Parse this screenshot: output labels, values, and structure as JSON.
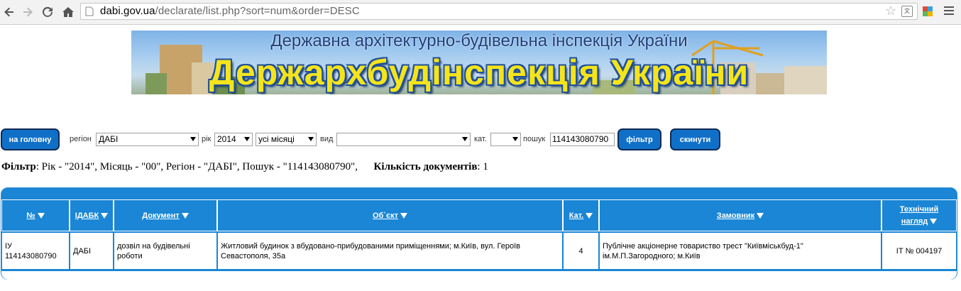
{
  "browser": {
    "url_host": "dabi.gov.ua",
    "url_path": "/declarate/list.php?sort=num&order=DESC"
  },
  "banner": {
    "subtitle": "Державна архітектурно-будівельна інспекція України",
    "title": "Держархбудінспекція України"
  },
  "form": {
    "home_button": "на головну",
    "region_label": "регіон",
    "region_value": "ДАБІ",
    "year_label": "рік",
    "year_value": "2014",
    "month_value": "усі місяці",
    "type_label": "вид",
    "type_value": "",
    "category_label": "кат.",
    "category_value": "",
    "search_label": "пошук",
    "search_value": "114143080790",
    "filter_button": "фільтр",
    "reset_button": "скинути"
  },
  "filter_summary": {
    "filter_label": "Фільтр",
    "filter_text": ": Рік - \"2014\", Місяць - \"00\", Регіон - \"ДАБІ\", Пошук - \"114143080790\",",
    "count_label": "Кількість документів",
    "count_value": ": 1"
  },
  "table": {
    "headers": {
      "num": "№",
      "idabk": "ІДАБК",
      "document": "Документ",
      "object": "Об`єкт",
      "category": "Кат.",
      "customer": "Замовник",
      "tech_line1": "Технічний",
      "tech_line2": "нагляд"
    },
    "rows": [
      {
        "num_line1": "ІУ",
        "num_line2": "114143080790",
        "idabk": "ДАБІ",
        "document": "дозвіл на будівельні роботи",
        "object": "Житловий будинок з вбудовано-прибудованими приміщеннями; м.Київ, вул. Героїв Севастополя, 35а",
        "category": "4",
        "customer": "Публічне акціонерне товариство трест \"Київміськбуд-1\" ім.М.П.Загородного; м.Київ",
        "tech": "ІТ № 004197"
      }
    ]
  },
  "colors": {
    "accent": "#1a86d5",
    "button": "#1070c8",
    "banner_title": "#f5e41a"
  }
}
